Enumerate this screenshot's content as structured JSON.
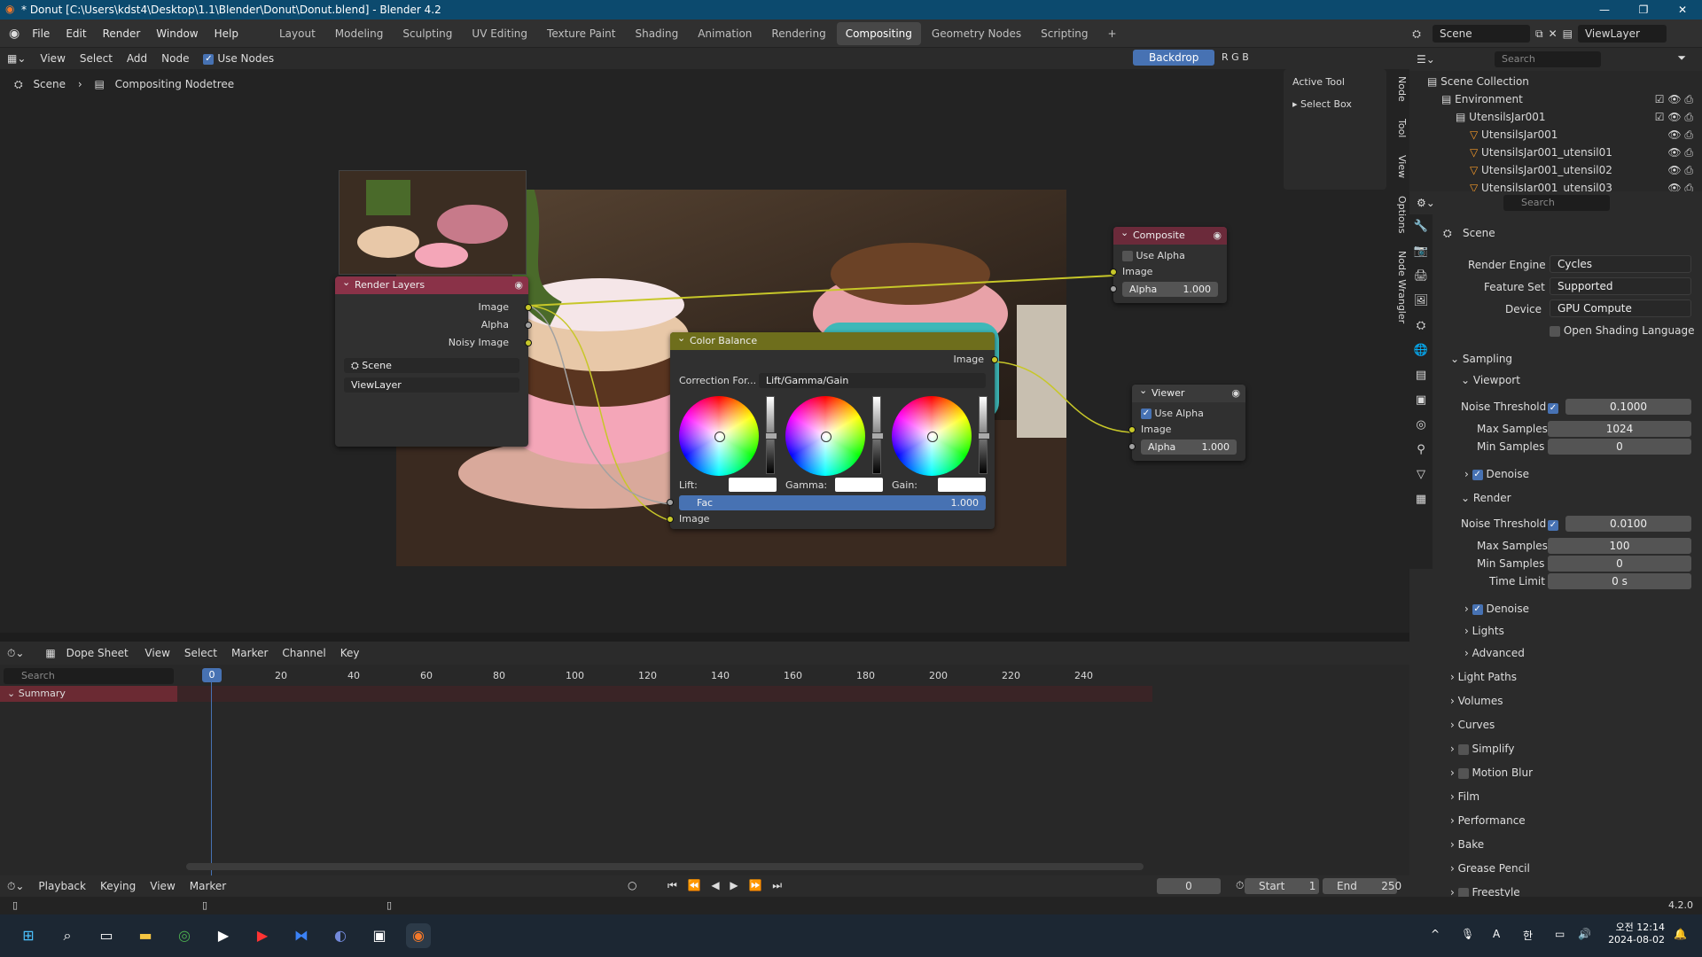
{
  "window": {
    "title": "* Donut [C:\\Users\\kdst4\\Desktop\\1.1\\Blender\\Donut\\Donut.blend] - Blender 4.2",
    "minimize": "—",
    "maximize": "❐",
    "close": "✕"
  },
  "menu": [
    "File",
    "Edit",
    "Render",
    "Window",
    "Help"
  ],
  "workspaces": [
    "Layout",
    "Modeling",
    "Sculpting",
    "UV Editing",
    "Texture Paint",
    "Shading",
    "Animation",
    "Rendering",
    "Compositing",
    "Geometry Nodes",
    "Scripting"
  ],
  "active_workspace": "Compositing",
  "scene_selector": {
    "scene": "Scene",
    "view_layer": "ViewLayer"
  },
  "node_header": {
    "view": "View",
    "select": "Select",
    "add": "Add",
    "node": "Node",
    "use_nodes": "Use Nodes",
    "backdrop": "Backdrop",
    "channels": [
      "R",
      "G",
      "B"
    ]
  },
  "breadcrumb": {
    "scene": "Scene",
    "tree": "Compositing Nodetree"
  },
  "sidebar_panel": {
    "title": "Active Tool",
    "tool": "Select Box",
    "tabs": [
      "Node",
      "Tool",
      "View",
      "Options",
      "Node Wrangler"
    ]
  },
  "nodes": {
    "render_layers": {
      "title": "Render Layers",
      "outputs": [
        "Image",
        "Alpha",
        "Noisy Image"
      ],
      "scene": "Scene",
      "layer": "ViewLayer"
    },
    "color_balance": {
      "title": "Color Balance",
      "output": "Image",
      "correction_label": "Correction For...",
      "correction_value": "Lift/Gamma/Gain",
      "lift": "Lift:",
      "gamma": "Gamma:",
      "gain": "Gain:",
      "fac_label": "Fac",
      "fac_value": "1.000",
      "input": "Image"
    },
    "composite": {
      "title": "Composite",
      "use_alpha": "Use Alpha",
      "image": "Image",
      "alpha_label": "Alpha",
      "alpha_value": "1.000"
    },
    "viewer": {
      "title": "Viewer",
      "use_alpha": "Use Alpha",
      "image": "Image",
      "alpha_label": "Alpha",
      "alpha_value": "1.000"
    }
  },
  "outliner": {
    "search_placeholder": "Search",
    "items": [
      {
        "label": "Scene Collection",
        "indent": 0
      },
      {
        "label": "Environment",
        "indent": 1
      },
      {
        "label": "UtensilsJar001",
        "indent": 2
      },
      {
        "label": "UtensilsJar001",
        "indent": 3
      },
      {
        "label": "UtensilsJar001_utensil01",
        "indent": 3
      },
      {
        "label": "UtensilsJar001_utensil02",
        "indent": 3
      },
      {
        "label": "UtensilsJar001_utensil03",
        "indent": 3
      }
    ]
  },
  "properties": {
    "search_placeholder": "Search",
    "context": "Scene",
    "render_engine_label": "Render Engine",
    "render_engine": "Cycles",
    "feature_set_label": "Feature Set",
    "feature_set": "Supported",
    "device_label": "Device",
    "device": "GPU Compute",
    "osl": "Open Shading Language",
    "sampling": "Sampling",
    "viewport": "Viewport",
    "vp_noise_label": "Noise Threshold",
    "vp_noise": "0.1000",
    "vp_max_label": "Max Samples",
    "vp_max": "1024",
    "vp_min_label": "Min Samples",
    "vp_min": "0",
    "denoise": "Denoise",
    "render": "Render",
    "r_noise_label": "Noise Threshold",
    "r_noise": "0.0100",
    "r_max_label": "Max Samples",
    "r_max": "100",
    "r_min_label": "Min Samples",
    "r_min": "0",
    "time_limit_label": "Time Limit",
    "time_limit": "0 s",
    "denoise2": "Denoise",
    "lights": "Lights",
    "advanced": "Advanced",
    "sections": [
      "Light Paths",
      "Volumes",
      "Curves",
      "Simplify",
      "Motion Blur",
      "Film",
      "Performance",
      "Bake",
      "Grease Pencil",
      "Freestyle"
    ]
  },
  "dopesheet": {
    "editor": "Dope Sheet",
    "menus": [
      "View",
      "Select",
      "Marker",
      "Channel",
      "Key"
    ],
    "search_placeholder": "Search",
    "summary": "Summary",
    "current_frame": "0",
    "ticks": [
      "20",
      "40",
      "60",
      "80",
      "100",
      "120",
      "140",
      "160",
      "180",
      "200",
      "220",
      "240"
    ]
  },
  "timeline": {
    "playback": "Playback",
    "keying": "Keying",
    "view": "View",
    "marker": "Marker",
    "frame": "0",
    "start_label": "Start",
    "start": "1",
    "end_label": "End",
    "end": "250"
  },
  "status": {
    "version": "4.2.0"
  },
  "taskbar": {
    "time": "오전 12:14",
    "date": "2024-08-02",
    "lang": "A",
    "ime": "한"
  },
  "colors": {
    "accent": "#4772b3",
    "render_layers_header": "#8a3248",
    "color_balance_header": "#6e6e1c",
    "socket_color": "#c7c729"
  }
}
